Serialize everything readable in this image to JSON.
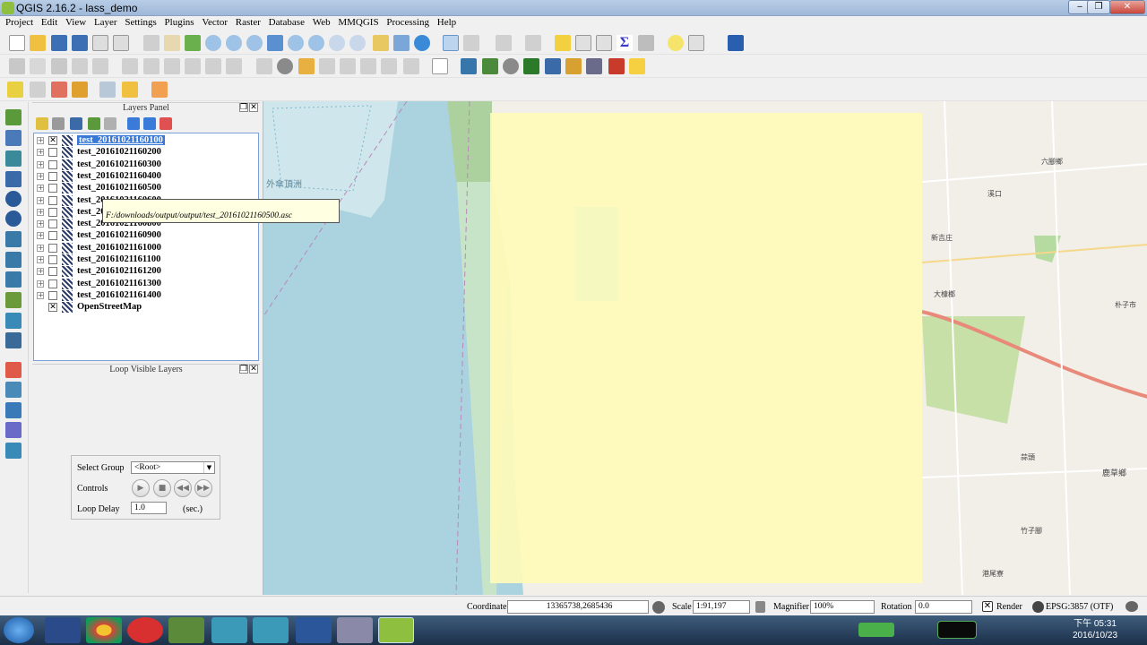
{
  "window": {
    "title": "QGIS 2.16.2 - lass_demo",
    "minimize": "‒",
    "maximize": "❐",
    "close": "✕"
  },
  "menu": [
    "Project",
    "Edit",
    "View",
    "Layer",
    "Settings",
    "Plugins",
    "Vector",
    "Raster",
    "Database",
    "Web",
    "MMQGIS",
    "Processing",
    "Help"
  ],
  "layers_panel": {
    "title": "Layers Panel",
    "layers": [
      {
        "name": "test_20161021160100",
        "checked": true,
        "selected": true
      },
      {
        "name": "test_20161021160200",
        "checked": false
      },
      {
        "name": "test_20161021160300",
        "checked": false
      },
      {
        "name": "test_20161021160400",
        "checked": false
      },
      {
        "name": "test_20161021160500",
        "checked": false
      },
      {
        "name": "test_20161021160600",
        "checked": false
      },
      {
        "name": "test_20161021160700",
        "checked": false
      },
      {
        "name": "test_20161021160800",
        "checked": false
      },
      {
        "name": "test_20161021160900",
        "checked": false
      },
      {
        "name": "test_20161021161000",
        "checked": false
      },
      {
        "name": "test_20161021161100",
        "checked": false
      },
      {
        "name": "test_20161021161200",
        "checked": false
      },
      {
        "name": "test_20161021161300",
        "checked": false
      },
      {
        "name": "test_20161021161400",
        "checked": false
      },
      {
        "name": "OpenStreetMap",
        "checked": true
      }
    ],
    "tooltip": "F:/downloads/output/output/test_20161021160500.asc"
  },
  "loop_panel": {
    "title": "Loop Visible Layers",
    "select_group_label": "Select Group",
    "select_group_value": "<Root>",
    "controls_label": "Controls",
    "loop_delay_label": "Loop Delay",
    "loop_delay_value": "1.0",
    "loop_delay_unit": "(sec.)"
  },
  "map": {
    "labels": [
      "外傘頂洲",
      "六腳鄉",
      "朴子市",
      "大槺榔",
      "新吉庄",
      "蒜頭",
      "鹿草鄉",
      "竹子腳",
      "溪口",
      "港尾寮"
    ],
    "overlay_color": "#fffab8"
  },
  "status": {
    "coordinate_label": "Coordinate",
    "coordinate_value": "13365738,2685436",
    "scale_label": "Scale",
    "scale_value": "1:91,197",
    "magnifier_label": "Magnifier",
    "magnifier_value": "100%",
    "rotation_label": "Rotation",
    "rotation_value": "0.0",
    "render_label": "Render",
    "crs": "EPSG:3857 (OTF)"
  },
  "taskbar": {
    "time": "下午 05:31",
    "date": "2016/10/23"
  }
}
